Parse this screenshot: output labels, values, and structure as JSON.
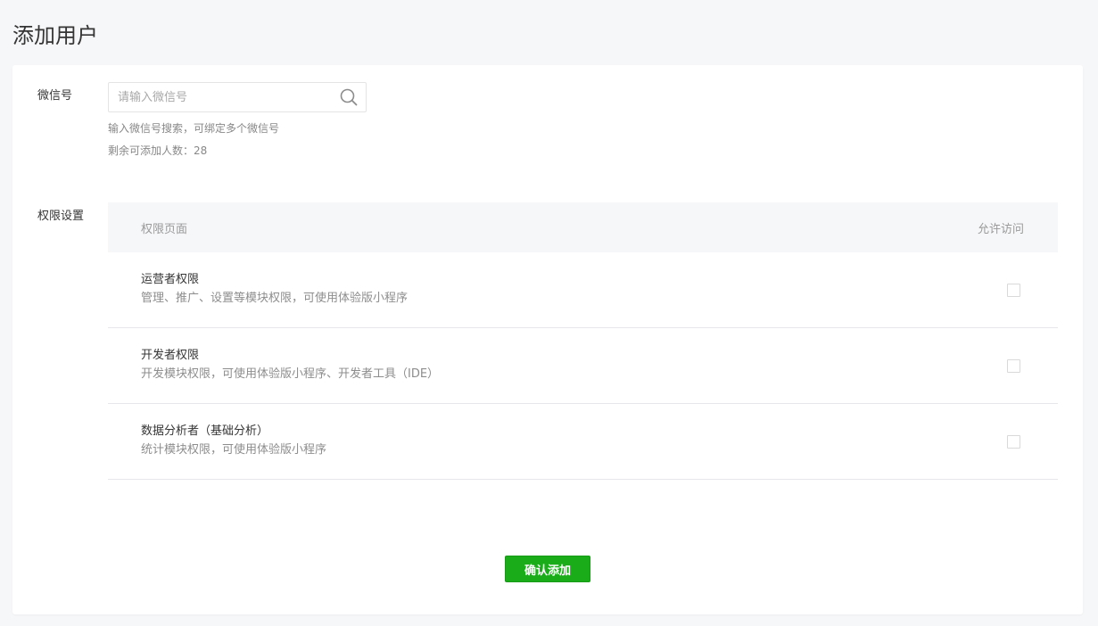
{
  "page": {
    "title": "添加用户"
  },
  "wechat": {
    "label": "微信号",
    "placeholder": "请输入微信号",
    "value": "",
    "hint": "输入微信号搜索，可绑定多个微信号",
    "remaining_label": "剩余可添加人数：",
    "remaining_count": "28"
  },
  "permissions": {
    "label": "权限设置",
    "header": {
      "page": "权限页面",
      "allow": "允许访问"
    },
    "rows": [
      {
        "title": "运营者权限",
        "desc": "管理、推广、设置等模块权限，可使用体验版小程序",
        "checked": false
      },
      {
        "title": "开发者权限",
        "desc": "开发模块权限，可使用体验版小程序、开发者工具（IDE）",
        "checked": false
      },
      {
        "title": "数据分析者（基础分析）",
        "desc": "统计模块权限，可使用体验版小程序",
        "checked": false
      }
    ]
  },
  "actions": {
    "confirm_label": "确认添加"
  },
  "colors": {
    "primary": "#1aad19",
    "background": "#f6f7f9",
    "border": "#e7e7eb"
  }
}
